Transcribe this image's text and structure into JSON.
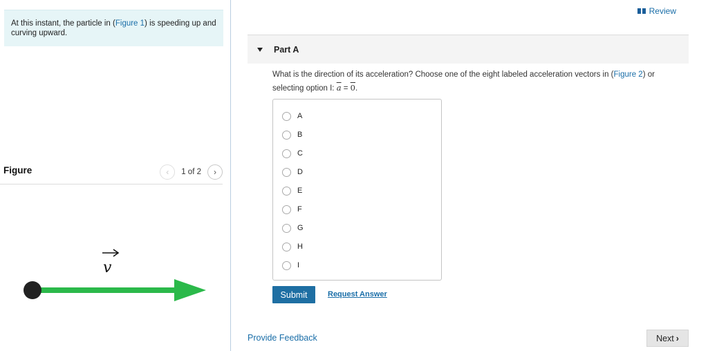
{
  "intro": {
    "text_before": "At this instant, the particle in (",
    "figure_link": "Figure 1",
    "text_after": ") is speeding up and curving upward."
  },
  "figure": {
    "title": "Figure",
    "pager": {
      "current": "1 of 2",
      "prev_icon": "chevron-left-icon",
      "next_icon": "chevron-right-icon"
    },
    "vector_label": "v",
    "particle_color": "#222222",
    "arrow_color": "#2bb94a"
  },
  "header": {
    "review_label": "Review",
    "review_icon": "book-icon"
  },
  "part": {
    "title": "Part A",
    "question_before": "What is the direction of its acceleration? Choose one of the eight labeled acceleration vectors in (",
    "figure_link": "Figure 2",
    "question_after": ") or selecting option I: ",
    "math_a": "a",
    "math_eq": " = ",
    "math_zero": "0",
    "math_end": "."
  },
  "choices": [
    "A",
    "B",
    "C",
    "D",
    "E",
    "F",
    "G",
    "H",
    "I"
  ],
  "actions": {
    "submit_label": "Submit",
    "request_label": "Request Answer"
  },
  "footer": {
    "feedback_label": "Provide Feedback",
    "next_label": "Next",
    "next_icon": "chevron-right-icon"
  },
  "colors": {
    "link": "#1a6ea8",
    "submit_bg": "#1e6fa3",
    "intro_bg": "#e6f5f7"
  }
}
